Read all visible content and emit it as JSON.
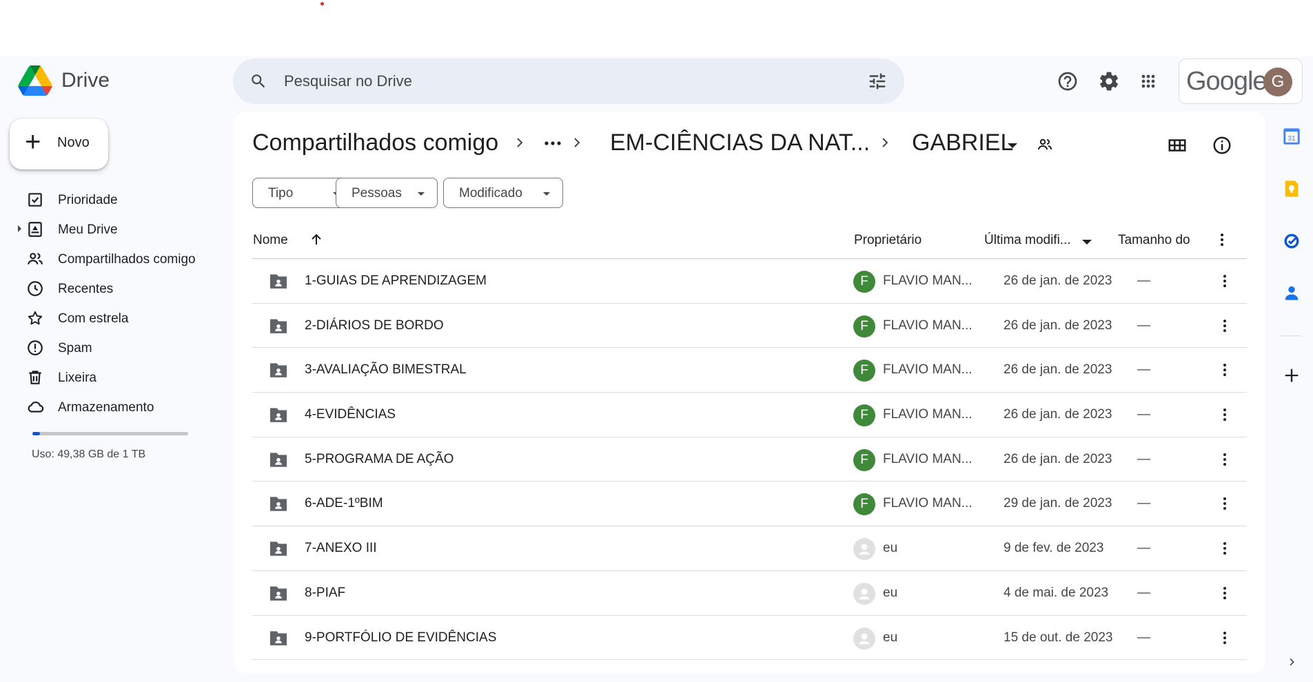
{
  "app": {
    "name": "Drive"
  },
  "search": {
    "placeholder": "Pesquisar no Drive"
  },
  "header": {
    "google_label": "Google",
    "avatar_letter": "G"
  },
  "new_button": {
    "label": "Novo"
  },
  "sidebar": {
    "items": [
      {
        "label": "Prioridade",
        "icon": "priority-icon"
      },
      {
        "label": "Meu Drive",
        "icon": "my-drive-icon"
      },
      {
        "label": "Compartilhados comigo",
        "icon": "shared-icon"
      },
      {
        "label": "Recentes",
        "icon": "clock-icon"
      },
      {
        "label": "Com estrela",
        "icon": "star-icon"
      },
      {
        "label": "Spam",
        "icon": "spam-icon"
      },
      {
        "label": "Lixeira",
        "icon": "trash-icon"
      },
      {
        "label": "Armazenamento",
        "icon": "cloud-icon"
      }
    ],
    "storage": {
      "used_fraction": 0.0482,
      "text": "Uso: 49,38 GB de 1 TB"
    }
  },
  "breadcrumb": {
    "root": "Compartilhados comigo",
    "middle": "EM-CIÊNCIAS DA NAT...",
    "current": "GABRIEL"
  },
  "filters": {
    "type": "Tipo",
    "people": "Pessoas",
    "modified": "Modificado"
  },
  "table": {
    "headers": {
      "name": "Nome",
      "owner": "Proprietário",
      "modified": "Última modifi...",
      "size": "Tamanho do"
    },
    "rows": [
      {
        "name": "1-GUIAS DE APRENDIZAGEM",
        "owner": "FLAVIO MAN...",
        "owner_initial": "F",
        "owner_color": "#3f8a3a",
        "modified": "26 de jan. de 2023",
        "size": "—"
      },
      {
        "name": "2-DIÁRIOS DE BORDO",
        "owner": "FLAVIO MAN...",
        "owner_initial": "F",
        "owner_color": "#3f8a3a",
        "modified": "26 de jan. de 2023",
        "size": "—"
      },
      {
        "name": "3-AVALIAÇÃO BIMESTRAL",
        "owner": "FLAVIO MAN...",
        "owner_initial": "F",
        "owner_color": "#3f8a3a",
        "modified": "26 de jan. de 2023",
        "size": "—"
      },
      {
        "name": "4-EVIDÊNCIAS",
        "owner": "FLAVIO MAN...",
        "owner_initial": "F",
        "owner_color": "#3f8a3a",
        "modified": "26 de jan. de 2023",
        "size": "—"
      },
      {
        "name": "5-PROGRAMA DE AÇÃO",
        "owner": "FLAVIO MAN...",
        "owner_initial": "F",
        "owner_color": "#3f8a3a",
        "modified": "26 de jan. de 2023",
        "size": "—"
      },
      {
        "name": "6-ADE-1ºBIM",
        "owner": "FLAVIO MAN...",
        "owner_initial": "F",
        "owner_color": "#3f8a3a",
        "modified": "29 de jan. de 2023",
        "size": "—"
      },
      {
        "name": "7-ANEXO III",
        "owner": "eu",
        "owner_initial": "",
        "owner_color": "#e0e0e0",
        "modified": "9 de fev. de 2023",
        "size": "—"
      },
      {
        "name": "8-PIAF",
        "owner": "eu",
        "owner_initial": "",
        "owner_color": "#e0e0e0",
        "modified": "4 de mai. de 2023",
        "size": "—"
      },
      {
        "name": "9-PORTFÓLIO DE EVIDÊNCIAS",
        "owner": "eu",
        "owner_initial": "",
        "owner_color": "#e0e0e0",
        "modified": "15 de out. de 2023",
        "size": "—"
      }
    ]
  },
  "right_rail": {
    "calendar_day": "31",
    "icons": [
      "calendar-icon",
      "keep-icon",
      "tasks-icon",
      "contacts-icon",
      "add-icon"
    ]
  }
}
